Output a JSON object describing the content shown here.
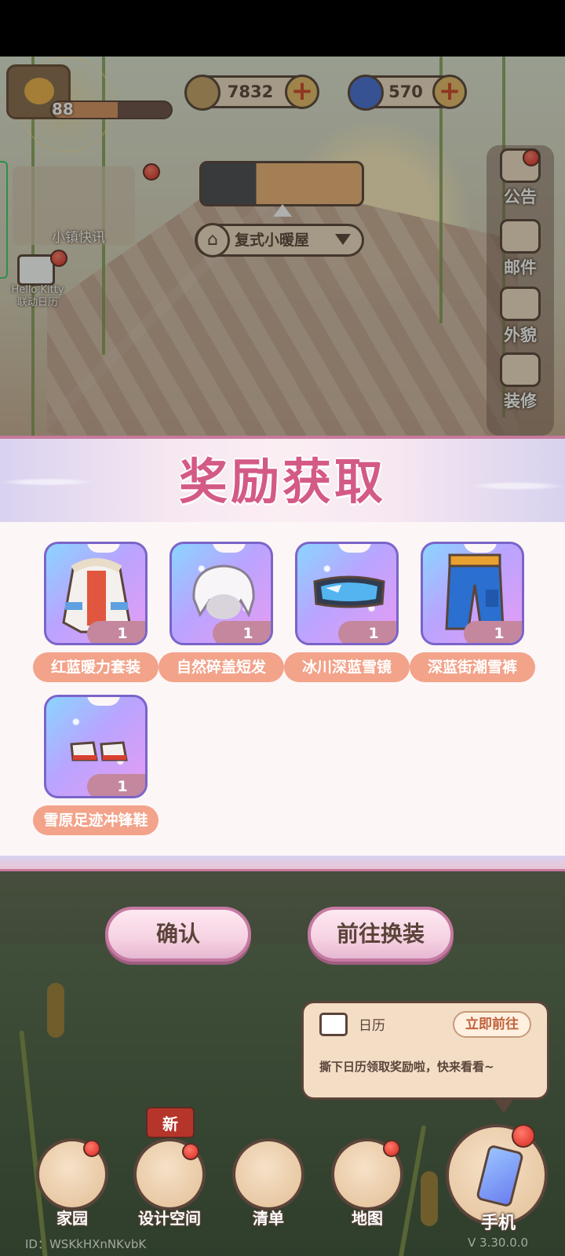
{
  "hud": {
    "level": "88",
    "xp_fraction": 0.55,
    "currencies": [
      {
        "icon": "coin-icon",
        "value": "7832",
        "color": "#c8a268"
      },
      {
        "icon": "swirl-gem-icon",
        "value": "570",
        "color": "#4a6fd8"
      }
    ]
  },
  "left_menu": {
    "news_label": "小镇快讯",
    "calendar_label_1": "Hello Kitty",
    "calendar_label_2": "联动日历"
  },
  "house_selector": {
    "name": "复式小暖屋"
  },
  "right_menu": [
    {
      "label": "公告",
      "icon": "announcement-icon"
    },
    {
      "label": "邮件",
      "icon": "mail-icon"
    },
    {
      "label": "外貌",
      "icon": "avatar-appearance-icon"
    },
    {
      "label": "装修",
      "icon": "house-decorate-icon"
    }
  ],
  "dialog": {
    "title": "奖励获取",
    "rewards": [
      {
        "name": "红蓝暖力套装",
        "qty": "1",
        "icon": "winter-jacket-icon"
      },
      {
        "name": "自然碎盖短发",
        "qty": "1",
        "icon": "white-short-hair-icon"
      },
      {
        "name": "冰川深蓝雪镜",
        "qty": "1",
        "icon": "ski-goggles-icon"
      },
      {
        "name": "深蓝街潮雪裤",
        "qty": "1",
        "icon": "blue-snow-pants-icon"
      },
      {
        "name": "雪原足迹冲锋鞋",
        "qty": "1",
        "icon": "snow-sneakers-icon"
      }
    ],
    "confirm_label": "确认",
    "goto_label": "前往换装"
  },
  "toast": {
    "title": "日历",
    "go_label": "立即前往",
    "message": "撕下日历领取奖励啦，快来看看~"
  },
  "bottom_nav": {
    "new_badge": "新",
    "items": [
      {
        "label": "家园",
        "icon": "home-icon"
      },
      {
        "label": "设计空间",
        "icon": "design-space-icon"
      },
      {
        "label": "清单",
        "icon": "checklist-icon"
      },
      {
        "label": "地图",
        "icon": "owl-map-icon"
      }
    ],
    "phone_label": "手机"
  },
  "footer": {
    "uid": "ID：WSKkHXnNKvbK",
    "version": "V 3.30.0.0"
  },
  "colors": {
    "title_pink": "#d45a86",
    "name_pill": "#f2a38a",
    "qty_pill": "#c4879d",
    "outline_brown": "#5b443a",
    "notify_red": "#d7281f"
  }
}
